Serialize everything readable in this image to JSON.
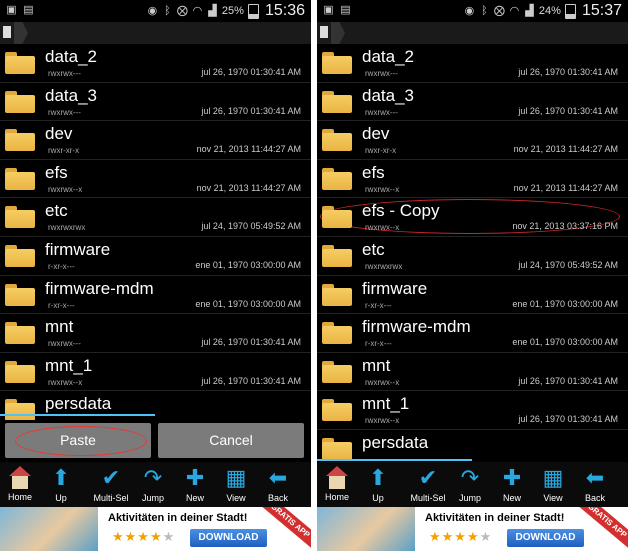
{
  "panels": [
    {
      "status": {
        "battery": "25%",
        "time": "15:36"
      },
      "files": [
        {
          "name": "data_2",
          "perm": "rwxrwx---",
          "date": "jul 26, 1970 01:30:41 AM"
        },
        {
          "name": "data_3",
          "perm": "rwxrwx---",
          "date": "jul 26, 1970 01:30:41 AM"
        },
        {
          "name": "dev",
          "perm": "rwxr-xr-x",
          "date": "nov 21, 2013 11:44:27 AM"
        },
        {
          "name": "efs",
          "perm": "rwxrwx--x",
          "date": "nov 21, 2013 11:44:27 AM"
        },
        {
          "name": "etc",
          "perm": "rwxrwxrwx",
          "date": "jul 24, 1970 05:49:52 AM"
        },
        {
          "name": "firmware",
          "perm": "r-xr-x---",
          "date": "ene 01, 1970 03:00:00 AM"
        },
        {
          "name": "firmware-mdm",
          "perm": "r-xr-x---",
          "date": "ene 01, 1970 03:00:00 AM"
        },
        {
          "name": "mnt",
          "perm": "rwxrwx---",
          "date": "jul 26, 1970 01:30:41 AM"
        },
        {
          "name": "mnt_1",
          "perm": "rwxrwx--x",
          "date": "jul 26, 1970 01:30:41 AM"
        },
        {
          "name": "persdata",
          "perm": "",
          "date": ""
        }
      ],
      "buttons": {
        "paste": "Paste",
        "cancel": "Cancel"
      }
    },
    {
      "status": {
        "battery": "24%",
        "time": "15:37"
      },
      "files": [
        {
          "name": "data_2",
          "perm": "rwxrwx---",
          "date": "jul 26, 1970 01:30:41 AM"
        },
        {
          "name": "data_3",
          "perm": "rwxrwx---",
          "date": "jul 26, 1970 01:30:41 AM"
        },
        {
          "name": "dev",
          "perm": "rwxr-xr-x",
          "date": "nov 21, 2013 11:44:27 AM"
        },
        {
          "name": "efs",
          "perm": "rwxrwx--x",
          "date": "nov 21, 2013 11:44:27 AM"
        },
        {
          "name": "efs - Copy",
          "perm": "rwxrwx--x",
          "date": "nov 21, 2013 03:37:16 PM"
        },
        {
          "name": "etc",
          "perm": "rwxrwxrwx",
          "date": "jul 24, 1970 05:49:52 AM"
        },
        {
          "name": "firmware",
          "perm": "r-xr-x---",
          "date": "ene 01, 1970 03:00:00 AM"
        },
        {
          "name": "firmware-mdm",
          "perm": "r-xr-x---",
          "date": "ene 01, 1970 03:00:00 AM"
        },
        {
          "name": "mnt",
          "perm": "rwxrwx--x",
          "date": "jul 26, 1970 01:30:41 AM"
        },
        {
          "name": "mnt_1",
          "perm": "rwxrwx--x",
          "date": "jul 26, 1970 01:30:41 AM"
        },
        {
          "name": "persdata",
          "perm": "",
          "date": ""
        }
      ]
    }
  ],
  "toolbar": {
    "home": "Home",
    "up": "Up",
    "multisel": "Multi-Sel",
    "jump": "Jump",
    "new": "New",
    "view": "View",
    "back": "Back"
  },
  "icons": {
    "up": "up-arrow-icon",
    "multisel": "checkmark-icon",
    "jump": "curved-arrow-icon",
    "new": "plus-icon",
    "view": "grid-icon",
    "back": "left-arrow-icon"
  },
  "ad": {
    "title": "Aktivitäten in deiner Stadt!",
    "download": "DOWNLOAD",
    "ribbon": "GRATIS APP",
    "rating_stars": 4
  },
  "colors": {
    "accent": "#29a8e0",
    "folder": "#f0c04f",
    "highlight": "#c62828"
  }
}
